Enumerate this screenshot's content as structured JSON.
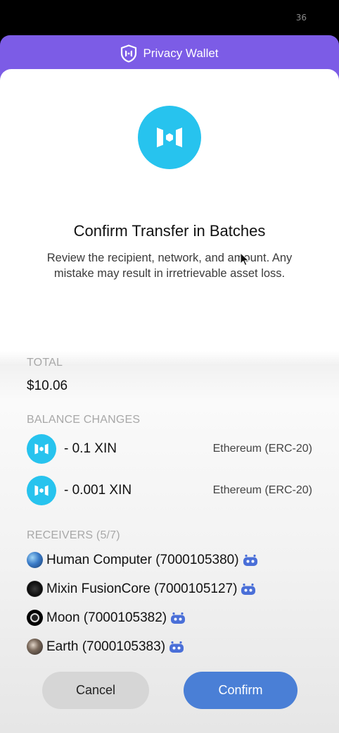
{
  "status_bar": {
    "text": "36"
  },
  "header": {
    "title": "Privacy Wallet",
    "icon": "shield-logo-icon",
    "accent": "#7c5ce6"
  },
  "hero": {
    "icon": "mixin-logo-icon",
    "title": "Confirm Transfer in Batches",
    "subtitle": "Review the recipient, network, and amount. Any mistake may result in irretrievable asset loss."
  },
  "total": {
    "label": "TOTAL",
    "value": "$10.06"
  },
  "balance_changes": {
    "label": "BALANCE CHANGES",
    "items": [
      {
        "amount": "- 0.1 XIN",
        "network": "Ethereum (ERC-20)",
        "icon": "xin-token-icon"
      },
      {
        "amount": "- 0.001 XIN",
        "network": "Ethereum (ERC-20)",
        "icon": "xin-token-icon"
      }
    ]
  },
  "receivers": {
    "label": "RECEIVERS (5/7)",
    "items": [
      {
        "name": "Human Computer (7000105380)",
        "icon": "bot-icon"
      },
      {
        "name": "Mixin FusionCore (7000105127)",
        "icon": "bot-icon"
      },
      {
        "name": "Moon (7000105382)",
        "icon": "bot-icon"
      },
      {
        "name": "Earth (7000105383)",
        "icon": "bot-icon"
      }
    ]
  },
  "buttons": {
    "cancel": "Cancel",
    "confirm": "Confirm"
  },
  "colors": {
    "token": "#27c3ee",
    "confirm": "#4a7fd6",
    "bot": "#4a6fd8"
  }
}
